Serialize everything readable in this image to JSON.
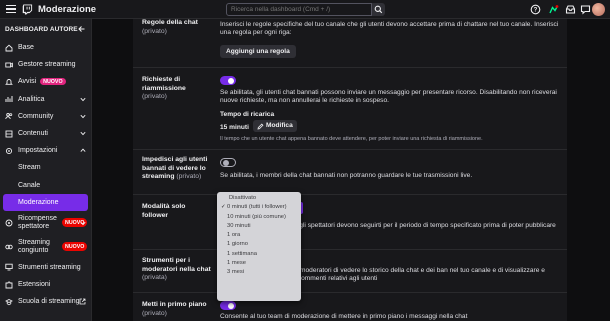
{
  "topbar": {
    "title": "Moderazione",
    "search_placeholder": "Ricerca nella dashboard (Cmd + /)"
  },
  "sidebar": {
    "header": "DASHBOARD AUTORE",
    "items": [
      {
        "label": "Base",
        "icon": "home-icon"
      },
      {
        "label": "Gestore streaming",
        "icon": "camera-icon"
      },
      {
        "label": "Avvisi",
        "icon": "bell-icon",
        "badge": "NUOVO"
      },
      {
        "label": "Analitica",
        "icon": "chart-icon"
      },
      {
        "label": "Community",
        "icon": "people-icon"
      },
      {
        "label": "Contenuti",
        "icon": "layers-icon"
      },
      {
        "label": "Impostazioni",
        "icon": "gear-icon"
      },
      {
        "label": "Stream"
      },
      {
        "label": "Canale"
      },
      {
        "label": "Moderazione"
      },
      {
        "label": "Ricompense spettatore",
        "icon": "gift-icon",
        "badge": "NUOVO"
      },
      {
        "label": "Streaming congiunto",
        "icon": "collab-icon",
        "badge": "NUOVO"
      },
      {
        "label": "Strumenti streaming",
        "icon": "monitor-icon"
      },
      {
        "label": "Estensioni",
        "icon": "puzzle-icon"
      },
      {
        "label": "Scuola di streaming",
        "icon": "school-icon"
      }
    ]
  },
  "settings": {
    "rules": {
      "label": "Regole della chat",
      "opt": "(privato)",
      "desc": "Inserisci le regole specifiche del tuo canale che gli utenti devono accettare prima di chattare nel tuo canale. Inserisci una regola per ogni riga:",
      "button": "Aggiungi una regola"
    },
    "unban": {
      "label": "Richieste di riammissione",
      "opt": "(privato)",
      "desc": "Se abilitata, gli utenti chat bannati possono inviare un messaggio per presentare ricorso. Disabilitando non riceverai nuove richieste, ma non annullerai le richieste in sospeso.",
      "cooldown_title": "Tempo di ricarica",
      "cooldown_value": "15 minuti",
      "edit_button": "Modifica",
      "cooldown_note": "Il tempo che un utente chat appena bannato deve attendere, per poter inviare una richiesta di riammissione."
    },
    "block_banned": {
      "label": "Impedisci agli utenti bannati di vedere lo streaming",
      "opt": "(privato)",
      "desc": "Se abilitata, i membri della chat bannati non potranno guardare le tue trasmissioni live."
    },
    "followers": {
      "label": "Modalità solo follower",
      "desc": "Se abilitata, gli spettatori devono seguirti per il periodo di tempo specificato prima di poter pubblicare dei"
    },
    "mod_tools": {
      "label": "Strumenti per i moderatori nella chat",
      "opt": "(privata)",
      "desc": "Consente ai moderatori di vedere lo storico della chat e dei ban nel tuo canale e di visualizzare e aggiungere commenti relativi agli utenti"
    },
    "pin": {
      "label": "Metti in primo piano",
      "opt": "(privato)",
      "desc": "Consente al tuo team di moderazione di mettere in primo piano i messaggi nella chat"
    }
  },
  "dropdown": {
    "options": [
      "Disattivato",
      "0 minuti (tutti i follower)",
      "10 minuti (più comune)",
      "30 minuti",
      "1 ora",
      "1 giorno",
      "1 settimana",
      "1 mese",
      "3 mesi"
    ],
    "selected_index": 1
  },
  "colors": {
    "accent": "#772ce8",
    "badge_new": "#eb0400",
    "badge_pink": "#e1257f",
    "background": "#0e0e10",
    "panel": "#18181b"
  }
}
